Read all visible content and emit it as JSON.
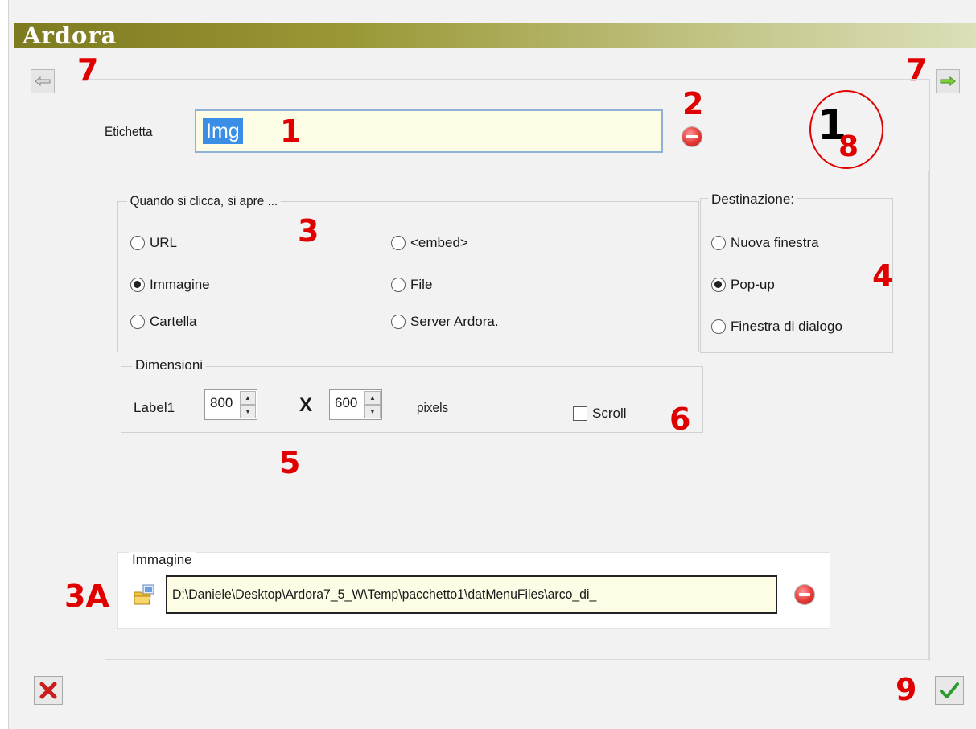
{
  "window": {
    "title": "Ardora"
  },
  "annotations": {
    "a1": "1",
    "a2": "2",
    "a3": "3",
    "a3a": "3A",
    "a4": "4",
    "a5": "5",
    "a6": "6",
    "a7_left": "7",
    "a7_right": "7",
    "a8_big": "1",
    "a8_sub": "8",
    "a9": "9"
  },
  "label_field": {
    "label": "Etichetta",
    "value": "Img"
  },
  "open_group": {
    "title": "Quando si clicca, si apre ...",
    "options": [
      {
        "label": "URL",
        "selected": false
      },
      {
        "label": "<embed>",
        "selected": false
      },
      {
        "label": "Immagine",
        "selected": true
      },
      {
        "label": "File",
        "selected": false
      },
      {
        "label": "Cartella",
        "selected": false
      },
      {
        "label": "Server Ardora.",
        "selected": false
      }
    ]
  },
  "destination_group": {
    "title": "Destinazione:",
    "options": [
      {
        "label": "Nuova finestra",
        "selected": false
      },
      {
        "label": "Pop-up",
        "selected": true
      },
      {
        "label": "Finestra di dialogo",
        "selected": false
      }
    ]
  },
  "dimensions_group": {
    "title": "Dimensioni",
    "label": "Label1",
    "width": "800",
    "separator": "X",
    "height": "600",
    "unit": "pixels",
    "scroll_label": "Scroll",
    "scroll_checked": false
  },
  "image_group": {
    "title": "Immagine",
    "path": "D:\\Daniele\\Desktop\\Ardora7_5_W\\Temp\\pacchetto1\\datMenuFiles\\arco_di_"
  },
  "icons": {
    "prev": "arrow-left-icon",
    "next": "arrow-right-icon",
    "clear": "minus-circle-icon",
    "browse": "folder-browse-icon",
    "cancel": "x-icon",
    "confirm": "checkmark-icon"
  },
  "colors": {
    "annotation": "#e00000",
    "selection": "#3a8ee6",
    "field_bg": "#fdfde6"
  }
}
